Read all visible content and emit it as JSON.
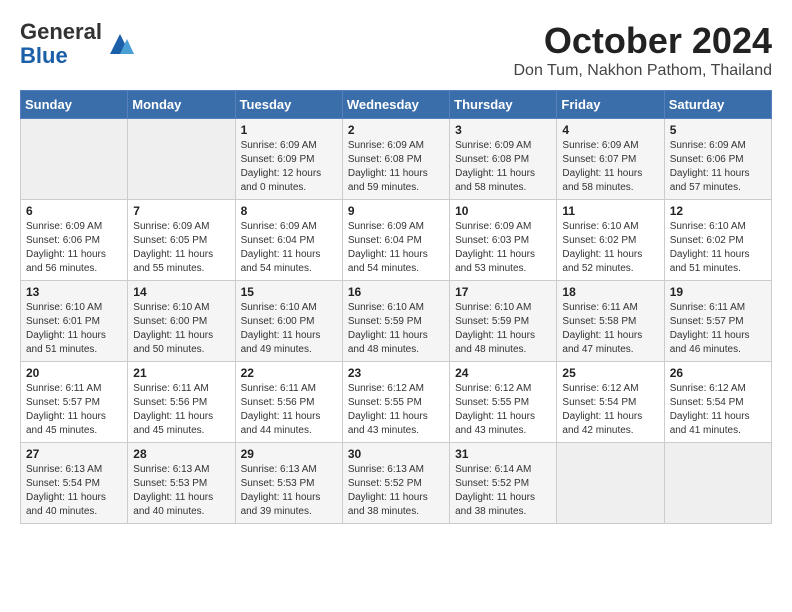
{
  "header": {
    "logo_general": "General",
    "logo_blue": "Blue",
    "month_title": "October 2024",
    "location": "Don Tum, Nakhon Pathom, Thailand"
  },
  "days_of_week": [
    "Sunday",
    "Monday",
    "Tuesday",
    "Wednesday",
    "Thursday",
    "Friday",
    "Saturday"
  ],
  "weeks": [
    [
      {
        "day": "",
        "empty": true
      },
      {
        "day": "",
        "empty": true
      },
      {
        "day": "1",
        "sunrise": "6:09 AM",
        "sunset": "6:09 PM",
        "daylight": "12 hours and 0 minutes."
      },
      {
        "day": "2",
        "sunrise": "6:09 AM",
        "sunset": "6:08 PM",
        "daylight": "11 hours and 59 minutes."
      },
      {
        "day": "3",
        "sunrise": "6:09 AM",
        "sunset": "6:08 PM",
        "daylight": "11 hours and 58 minutes."
      },
      {
        "day": "4",
        "sunrise": "6:09 AM",
        "sunset": "6:07 PM",
        "daylight": "11 hours and 58 minutes."
      },
      {
        "day": "5",
        "sunrise": "6:09 AM",
        "sunset": "6:06 PM",
        "daylight": "11 hours and 57 minutes."
      }
    ],
    [
      {
        "day": "6",
        "sunrise": "6:09 AM",
        "sunset": "6:06 PM",
        "daylight": "11 hours and 56 minutes."
      },
      {
        "day": "7",
        "sunrise": "6:09 AM",
        "sunset": "6:05 PM",
        "daylight": "11 hours and 55 minutes."
      },
      {
        "day": "8",
        "sunrise": "6:09 AM",
        "sunset": "6:04 PM",
        "daylight": "11 hours and 54 minutes."
      },
      {
        "day": "9",
        "sunrise": "6:09 AM",
        "sunset": "6:04 PM",
        "daylight": "11 hours and 54 minutes."
      },
      {
        "day": "10",
        "sunrise": "6:09 AM",
        "sunset": "6:03 PM",
        "daylight": "11 hours and 53 minutes."
      },
      {
        "day": "11",
        "sunrise": "6:10 AM",
        "sunset": "6:02 PM",
        "daylight": "11 hours and 52 minutes."
      },
      {
        "day": "12",
        "sunrise": "6:10 AM",
        "sunset": "6:02 PM",
        "daylight": "11 hours and 51 minutes."
      }
    ],
    [
      {
        "day": "13",
        "sunrise": "6:10 AM",
        "sunset": "6:01 PM",
        "daylight": "11 hours and 51 minutes."
      },
      {
        "day": "14",
        "sunrise": "6:10 AM",
        "sunset": "6:00 PM",
        "daylight": "11 hours and 50 minutes."
      },
      {
        "day": "15",
        "sunrise": "6:10 AM",
        "sunset": "6:00 PM",
        "daylight": "11 hours and 49 minutes."
      },
      {
        "day": "16",
        "sunrise": "6:10 AM",
        "sunset": "5:59 PM",
        "daylight": "11 hours and 48 minutes."
      },
      {
        "day": "17",
        "sunrise": "6:10 AM",
        "sunset": "5:59 PM",
        "daylight": "11 hours and 48 minutes."
      },
      {
        "day": "18",
        "sunrise": "6:11 AM",
        "sunset": "5:58 PM",
        "daylight": "11 hours and 47 minutes."
      },
      {
        "day": "19",
        "sunrise": "6:11 AM",
        "sunset": "5:57 PM",
        "daylight": "11 hours and 46 minutes."
      }
    ],
    [
      {
        "day": "20",
        "sunrise": "6:11 AM",
        "sunset": "5:57 PM",
        "daylight": "11 hours and 45 minutes."
      },
      {
        "day": "21",
        "sunrise": "6:11 AM",
        "sunset": "5:56 PM",
        "daylight": "11 hours and 45 minutes."
      },
      {
        "day": "22",
        "sunrise": "6:11 AM",
        "sunset": "5:56 PM",
        "daylight": "11 hours and 44 minutes."
      },
      {
        "day": "23",
        "sunrise": "6:12 AM",
        "sunset": "5:55 PM",
        "daylight": "11 hours and 43 minutes."
      },
      {
        "day": "24",
        "sunrise": "6:12 AM",
        "sunset": "5:55 PM",
        "daylight": "11 hours and 43 minutes."
      },
      {
        "day": "25",
        "sunrise": "6:12 AM",
        "sunset": "5:54 PM",
        "daylight": "11 hours and 42 minutes."
      },
      {
        "day": "26",
        "sunrise": "6:12 AM",
        "sunset": "5:54 PM",
        "daylight": "11 hours and 41 minutes."
      }
    ],
    [
      {
        "day": "27",
        "sunrise": "6:13 AM",
        "sunset": "5:54 PM",
        "daylight": "11 hours and 40 minutes."
      },
      {
        "day": "28",
        "sunrise": "6:13 AM",
        "sunset": "5:53 PM",
        "daylight": "11 hours and 40 minutes."
      },
      {
        "day": "29",
        "sunrise": "6:13 AM",
        "sunset": "5:53 PM",
        "daylight": "11 hours and 39 minutes."
      },
      {
        "day": "30",
        "sunrise": "6:13 AM",
        "sunset": "5:52 PM",
        "daylight": "11 hours and 38 minutes."
      },
      {
        "day": "31",
        "sunrise": "6:14 AM",
        "sunset": "5:52 PM",
        "daylight": "11 hours and 38 minutes."
      },
      {
        "day": "",
        "empty": true
      },
      {
        "day": "",
        "empty": true
      }
    ]
  ],
  "labels": {
    "sunrise_label": "Sunrise:",
    "sunset_label": "Sunset:",
    "daylight_label": "Daylight: "
  }
}
